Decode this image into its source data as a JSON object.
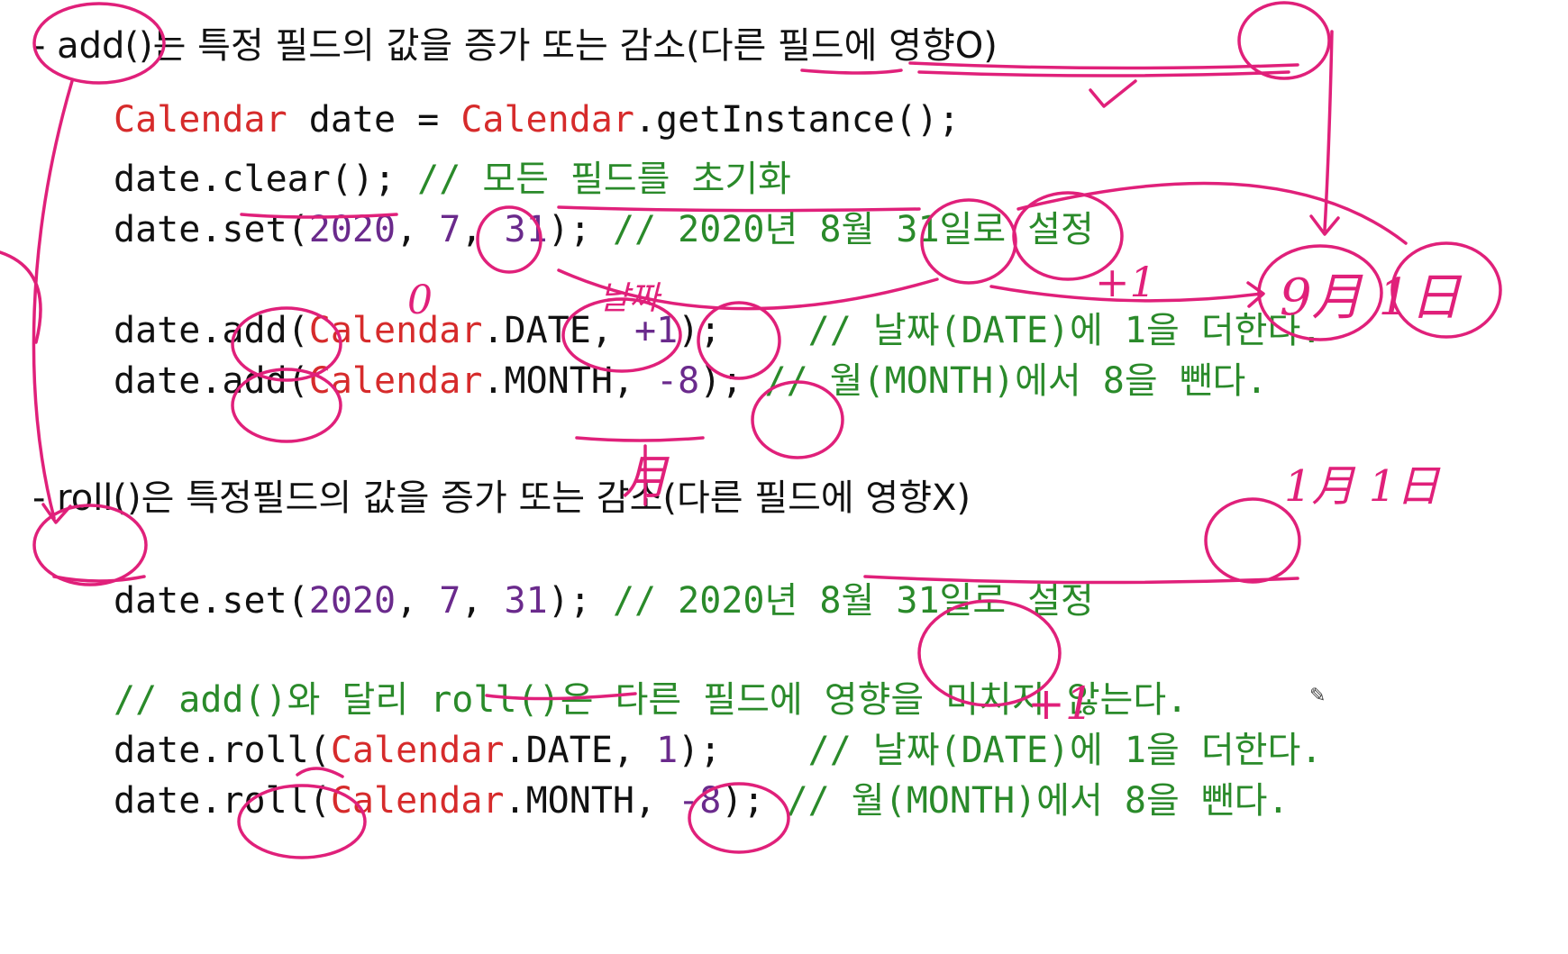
{
  "heading_add": "- add()는 특정 필드의 값을 증가 또는 감소(다른 필드에 영향O)",
  "heading_roll": "- roll()은 특정필드의 값을 증가 또는 감소(다른 필드에 영향X)",
  "code_add": [
    {
      "t1": "Calendar",
      "t2": " date = ",
      "t3": "Calendar",
      "t4": ".getInstance();"
    },
    {
      "a": "date.clear(); ",
      "c": "// 모든 필드를 초기화"
    },
    {
      "a": "date.set(",
      "n1": "2020",
      "b": ", ",
      "n2": "7",
      "d": ", ",
      "n3": "31",
      "e": "); ",
      "c": "// 2020년 8월 31일로 설정"
    },
    {
      "a": "date.add(",
      "k": "Calendar",
      "b": ".DATE, ",
      "n": "+1",
      "e": ");    ",
      "c": "// 날짜(DATE)에 1을 더한다."
    },
    {
      "a": "date.add(",
      "k": "Calendar",
      "b": ".MONTH, ",
      "n": "-8",
      "e": "); ",
      "c": "// 월(MONTH)에서 8을 뺀다."
    }
  ],
  "code_roll": [
    {
      "a": "date.set(",
      "n1": "2020",
      "b": ", ",
      "n2": "7",
      "d": ", ",
      "n3": "31",
      "e": "); ",
      "c": "// 2020년 8월 31일로 설정"
    },
    {
      "c": "// add()와 달리 roll()은 다른 필드에 영향을 미치지 않는다."
    },
    {
      "a": "date.roll(",
      "k": "Calendar",
      "b": ".DATE, ",
      "n": "1",
      "e": ");    ",
      "c": "// 날짜(DATE)에 1을 더한다."
    },
    {
      "a": "date.roll(",
      "k": "Calendar",
      "b": ".MONTH, ",
      "n": "-8",
      "e": "); ",
      "c": "// 월(MONTH)에서 8을 뺀다."
    }
  ],
  "annotations": {
    "zero": "0",
    "date_note": "날짜",
    "plus_one_a": "+1",
    "sep_first": "9月 1日",
    "month_mark": "月",
    "jan_first": "1月 1日",
    "plus_one_b": "+1"
  },
  "colors": {
    "ink": "#e0207a",
    "class": "#d62b2b",
    "number": "#6a2a8c",
    "comment": "#2a8a2a"
  }
}
